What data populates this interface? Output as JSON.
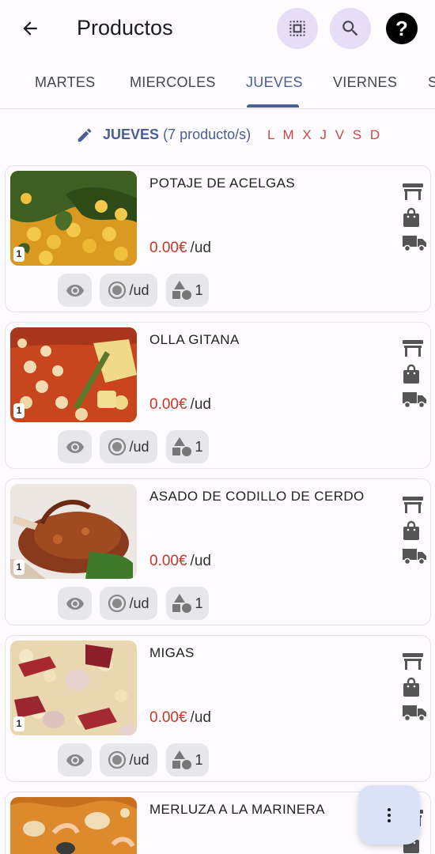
{
  "appbar": {
    "title": "Productos",
    "back_icon": "arrow-back-icon",
    "select_icon": "select-all-icon",
    "search_icon": "search-icon",
    "help_icon": "help-icon",
    "accent_bg": "#e8ddf6"
  },
  "tabs": [
    {
      "label": "MARTES",
      "active": false
    },
    {
      "label": "MIERCOLES",
      "active": false
    },
    {
      "label": "JUEVES",
      "active": true
    },
    {
      "label": "VIERNES",
      "active": false
    },
    {
      "label": "S",
      "active": false
    }
  ],
  "day_header": {
    "day": "JUEVES",
    "count": "(7 producto/s)",
    "letters": "L M X J V S D"
  },
  "products": [
    {
      "name": "POTAJE DE ACELGAS",
      "price": "0.00€",
      "unit": "/ud",
      "qty_badge": "1",
      "unit_chip": "/ud",
      "shape_chip": "1"
    },
    {
      "name": "OLLA GITANA",
      "price": "0.00€",
      "unit": "/ud",
      "qty_badge": "1",
      "unit_chip": "/ud",
      "shape_chip": "1"
    },
    {
      "name": "ASADO DE CODILLO DE CERDO",
      "price": "0.00€",
      "unit": "/ud",
      "qty_badge": "1",
      "unit_chip": "/ud",
      "shape_chip": "1"
    },
    {
      "name": "MIGAS",
      "price": "0.00€",
      "unit": "/ud",
      "qty_badge": "1",
      "unit_chip": "/ud",
      "shape_chip": "1"
    },
    {
      "name": "MERLUZA A LA MARINERA",
      "price": "",
      "unit": "",
      "qty_badge": "",
      "unit_chip": "",
      "shape_chip": ""
    }
  ],
  "colors": {
    "primary": "#4a5f96",
    "price": "#c0392b",
    "weekday_letters": "#c64a4a",
    "fab_bg": "#dbe2f8"
  },
  "fab_icon": "more-vert-icon"
}
